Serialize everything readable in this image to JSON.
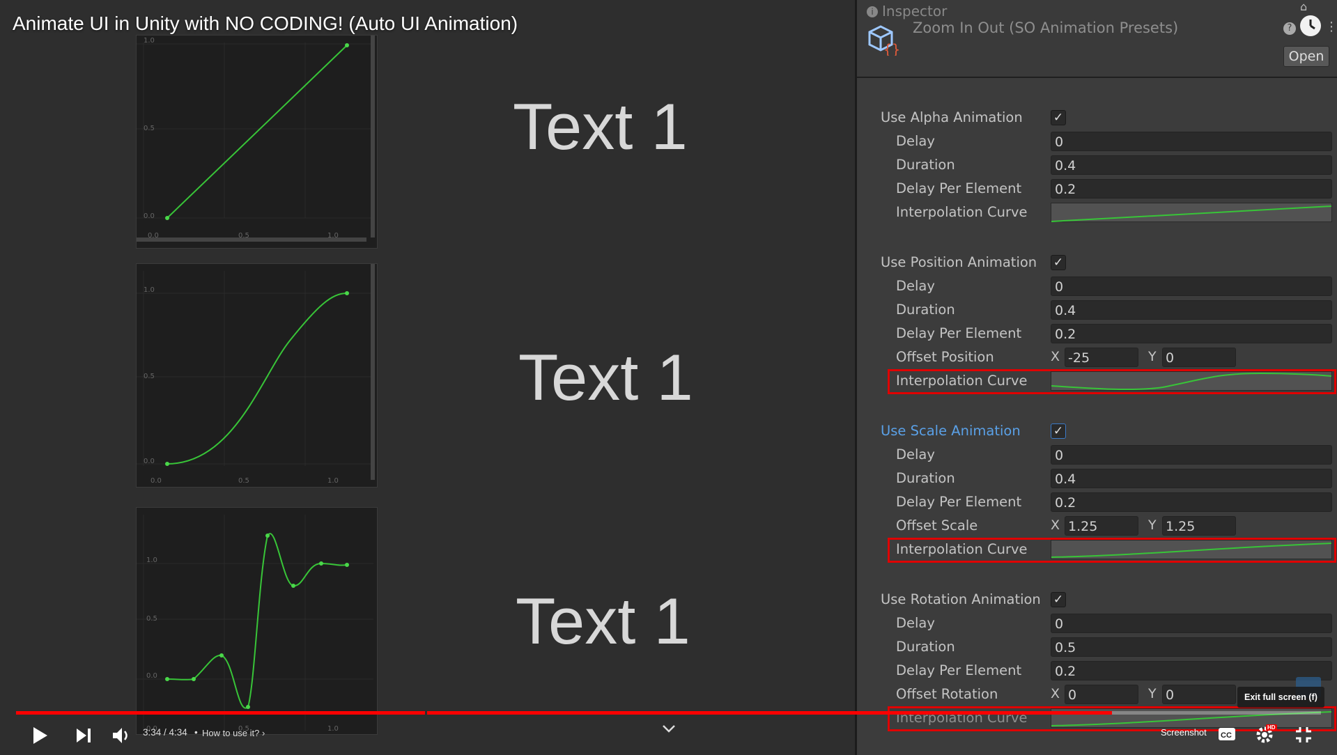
{
  "video": {
    "title": "Animate UI in Unity with NO CODING! (Auto UI Animation)",
    "preview_texts": [
      "Text 1",
      "Text 1",
      "Text 1"
    ],
    "graphs": [
      {
        "name": "linear",
        "y_ticks": [
          "1.0",
          "0.5",
          "0.0"
        ],
        "x_ticks": [
          "0.0",
          "0.5",
          "1.0"
        ]
      },
      {
        "name": "ease-in-out",
        "y_ticks": [
          "1.0",
          "0.5",
          "0.0"
        ],
        "x_ticks": [
          "0.0",
          "0.5",
          "1.0"
        ]
      },
      {
        "name": "elastic",
        "y_ticks": [
          "1.0",
          "0.5",
          "0.0"
        ],
        "x_ticks": [
          "0.0",
          "0.5",
          "1.0"
        ]
      }
    ]
  },
  "inspector": {
    "tab_label": "Inspector",
    "asset_name": "Zoom In Out (SO Animation Presets)",
    "open_label": "Open",
    "alpha": {
      "label": "Use Alpha Animation",
      "checked": "✓",
      "delay_label": "Delay",
      "delay": "0",
      "duration_label": "Duration",
      "duration": "0.4",
      "delay_per_element_label": "Delay Per Element",
      "delay_per_element": "0.2",
      "curve_label": "Interpolation Curve"
    },
    "position": {
      "label": "Use Position Animation",
      "checked": "✓",
      "delay_label": "Delay",
      "delay": "0",
      "duration_label": "Duration",
      "duration": "0.4",
      "delay_per_element_label": "Delay Per Element",
      "delay_per_element": "0.2",
      "offset_label": "Offset Position",
      "x_label": "X",
      "x": "-25",
      "y_label": "Y",
      "y": "0",
      "curve_label": "Interpolation Curve"
    },
    "scale": {
      "label": "Use Scale Animation",
      "checked": "✓",
      "delay_label": "Delay",
      "delay": "0",
      "duration_label": "Duration",
      "duration": "0.4",
      "delay_per_element_label": "Delay Per Element",
      "delay_per_element": "0.2",
      "offset_label": "Offset Scale",
      "x_label": "X",
      "x": "1.25",
      "y_label": "Y",
      "y": "1.25",
      "curve_label": "Interpolation Curve"
    },
    "rotation": {
      "label": "Use Rotation Animation",
      "checked": "✓",
      "delay_label": "Delay",
      "delay": "0",
      "duration_label": "Duration",
      "duration": "0.5",
      "delay_per_element_label": "Delay Per Element",
      "delay_per_element": "0.2",
      "offset_label": "Offset Rotation",
      "x_label": "X",
      "x": "0",
      "y_label": "Y",
      "y": "0",
      "curve_label": "Interpolation Curve"
    }
  },
  "player": {
    "progress": 0.84,
    "time": "3:34 / 4:34",
    "separator": "•",
    "chapter": "How to use it?",
    "screenshot_label": "Screenshot",
    "exit_tooltip": "Exit full screen (f)",
    "hd_badge": "HD",
    "accent_color": "#ff0000",
    "icons": [
      "play-icon",
      "next-icon",
      "volume-icon",
      "chevron-down-icon",
      "captions-icon",
      "settings-icon",
      "exit-fullscreen-icon"
    ]
  }
}
